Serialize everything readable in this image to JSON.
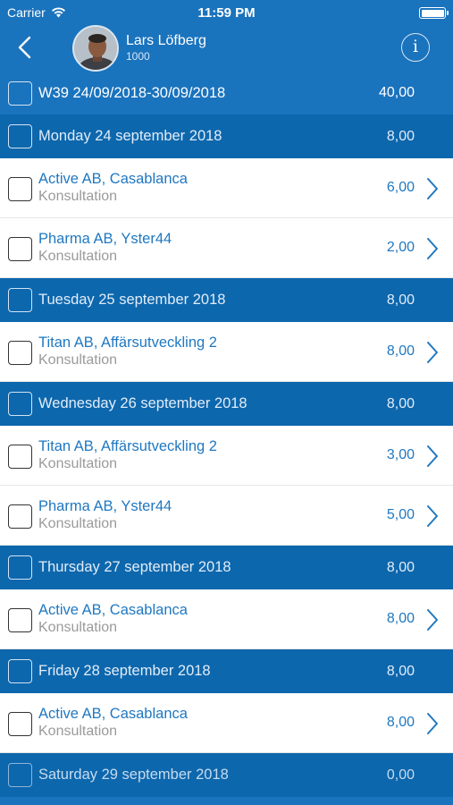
{
  "status": {
    "carrier": "Carrier",
    "time": "11:59 PM"
  },
  "header": {
    "user_name": "Lars Löfberg",
    "user_id": "1000",
    "info_symbol": "i"
  },
  "week": {
    "label": "W39 24/09/2018-30/09/2018",
    "total": "40,00"
  },
  "days": [
    {
      "label": "Monday 24 september 2018",
      "total": "8,00",
      "entries": [
        {
          "title": "Active AB, Casablanca",
          "subtitle": "Konsultation",
          "hours": "6,00"
        },
        {
          "title": "Pharma AB, Yster44",
          "subtitle": "Konsultation",
          "hours": "2,00"
        }
      ]
    },
    {
      "label": "Tuesday 25 september 2018",
      "total": "8,00",
      "entries": [
        {
          "title": "Titan AB, Affärsutveckling 2",
          "subtitle": "Konsultation",
          "hours": "8,00"
        }
      ]
    },
    {
      "label": "Wednesday 26 september 2018",
      "total": "8,00",
      "entries": [
        {
          "title": "Titan AB, Affärsutveckling 2",
          "subtitle": "Konsultation",
          "hours": "3,00"
        },
        {
          "title": "Pharma AB, Yster44",
          "subtitle": "Konsultation",
          "hours": "5,00"
        }
      ]
    },
    {
      "label": "Thursday 27 september 2018",
      "total": "8,00",
      "entries": [
        {
          "title": "Active AB, Casablanca",
          "subtitle": "Konsultation",
          "hours": "8,00"
        }
      ]
    },
    {
      "label": "Friday 28 september 2018",
      "total": "8,00",
      "entries": [
        {
          "title": "Active AB, Casablanca",
          "subtitle": "Konsultation",
          "hours": "8,00"
        }
      ]
    },
    {
      "label": "Saturday 29 september 2018",
      "total": "0,00",
      "entries": []
    }
  ],
  "colors": {
    "header_blue": "#1a73bd",
    "day_blue": "#0d67ad",
    "link_blue": "#1f78c1",
    "subtitle_gray": "#9a9a9a"
  }
}
